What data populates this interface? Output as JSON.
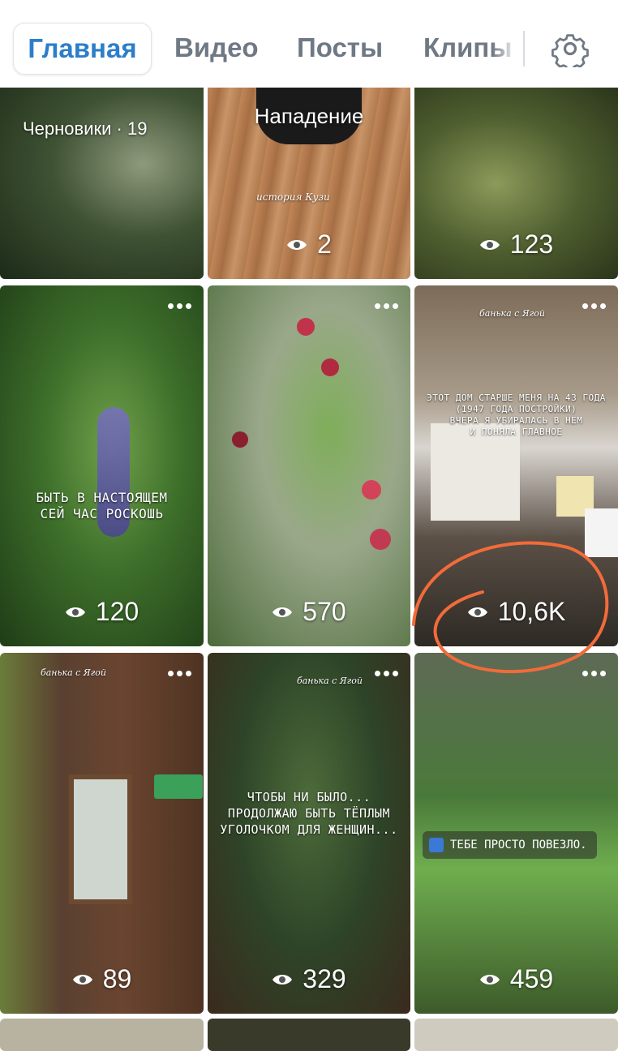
{
  "tabs": {
    "main": "Главная",
    "video": "Видео",
    "posts": "Посты",
    "clips": "Клипы"
  },
  "colors": {
    "active_tab": "#2d7ec9",
    "inactive_tab": "#6f7985",
    "annotation_circle": "#f26b3a"
  },
  "tiles": [
    {
      "drafts_label": "Черновики · 19"
    },
    {
      "title": "Нападение",
      "script": "история Кузи",
      "views": "2"
    },
    {
      "views": "123"
    },
    {
      "overlay": [
        "БЫТЬ В НАСТОЯЩЕМ",
        "СЕЙ ЧАС РОСКОШЬ"
      ],
      "views": "120"
    },
    {
      "views": "570"
    },
    {
      "script": "банька с Ягой",
      "overlay": [
        "ЭТОТ ДОМ СТАРШЕ МЕНЯ НА 43 ГОДА",
        "(1947 ГОДА ПОСТРОЙКИ)",
        "ВЧЕРА Я УБИРАЛАСЬ В НЕМ",
        "И ПОНЯЛА ГЛАВНОЕ"
      ],
      "views": "10,6K"
    },
    {
      "script": "банька с Ягой",
      "views": "89"
    },
    {
      "script": "банька с Ягой",
      "overlay": [
        "ЧТОБЫ НИ БЫЛО...",
        "ПРОДОЛЖАЮ БЫТЬ ТЁПЛЫМ",
        "УГОЛОЧКОМ ДЛЯ ЖЕНЩИН..."
      ],
      "views": "329"
    },
    {
      "sticker": "ТЕБЕ ПРОСТО ПОВЕЗЛО.",
      "views": "459"
    }
  ]
}
